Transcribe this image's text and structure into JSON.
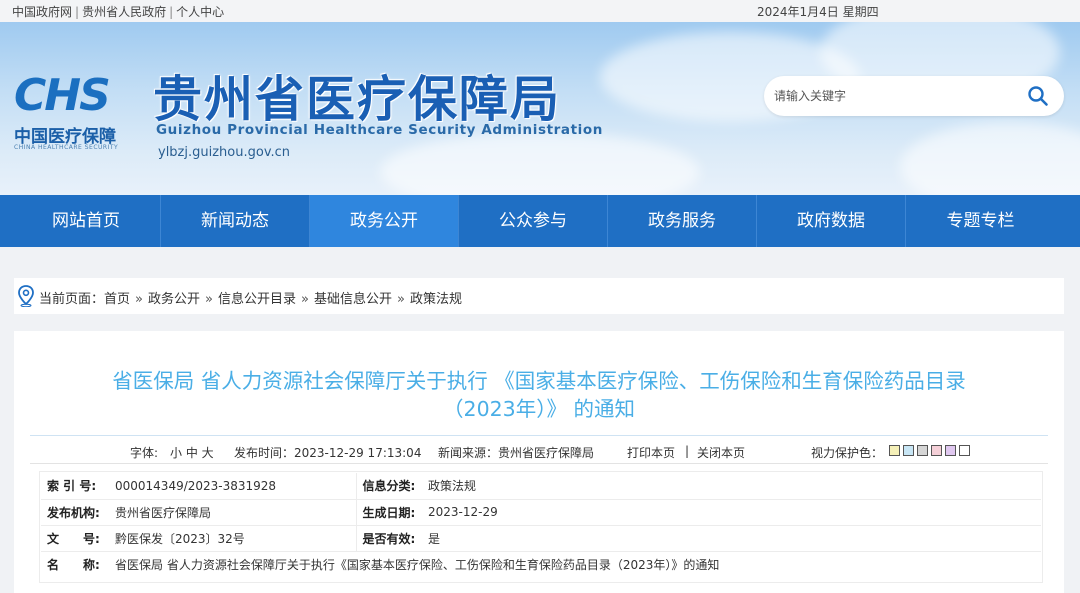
{
  "topbar": {
    "links": [
      "中国政府网",
      "贵州省人民政府",
      "个人中心"
    ],
    "separator": "|",
    "date": "2024年1月4日 星期四"
  },
  "header": {
    "logo_mark": "CHS",
    "logo_cn": "中国医疗保障",
    "logo_en": "CHINA HEALTHCARE SECURITY",
    "title": "贵州省医疗保障局",
    "title_en": "Guizhou Provincial Healthcare Security Administration",
    "url": "ylbzj.guizhou.gov.cn"
  },
  "search": {
    "placeholder": "请输入关键字",
    "icon": "search-icon"
  },
  "nav": {
    "items": [
      "网站首页",
      "新闻动态",
      "政务公开",
      "公众参与",
      "政务服务",
      "政府数据",
      "专题专栏"
    ],
    "active_index": 2
  },
  "breadcrumb": {
    "prefix": "当前页面：",
    "items": [
      "首页",
      "政务公开",
      "信息公开目录",
      "基础信息公开",
      "政策法规"
    ],
    "arrow": "»"
  },
  "article": {
    "title_line1": "省医保局 省人力资源社会保障厅关于执行 《国家基本医疗保险、工伤保险和生育保险药品目录",
    "title_line2": "（2023年）》 的通知",
    "meta": {
      "font_label": "字体:",
      "font_sizes": "小 中 大",
      "publish_time": "发布时间：2023-12-29 17:13:04",
      "source": "新闻来源：贵州省医疗保障局",
      "print": "打印本页",
      "bar": "|",
      "close": "关闭本页",
      "eye_label": "视力保护色：",
      "eye_colors": [
        "#f5f0b8",
        "#c8e6f5",
        "#d6d6d6",
        "#f5d0d8",
        "#e0c8f0",
        "#ffffff"
      ]
    },
    "info": {
      "index_label": "索 引 号:",
      "index_value": "000014349/2023-3831928",
      "category_label": "信息分类:",
      "category_value": "政策法规",
      "org_label": "发布机构:",
      "org_value": "贵州省医疗保障局",
      "date_label": "生成日期:",
      "date_value": "2023-12-29",
      "doc_label": "文　　号:",
      "doc_value": "黔医保发〔2023〕32号",
      "valid_label": "是否有效:",
      "valid_value": "是",
      "name_label": "名　　称:",
      "name_value": "省医保局 省人力资源社会保障厅关于执行《国家基本医疗保险、工伤保险和生育保险药品目录（2023年）》的通知"
    }
  }
}
